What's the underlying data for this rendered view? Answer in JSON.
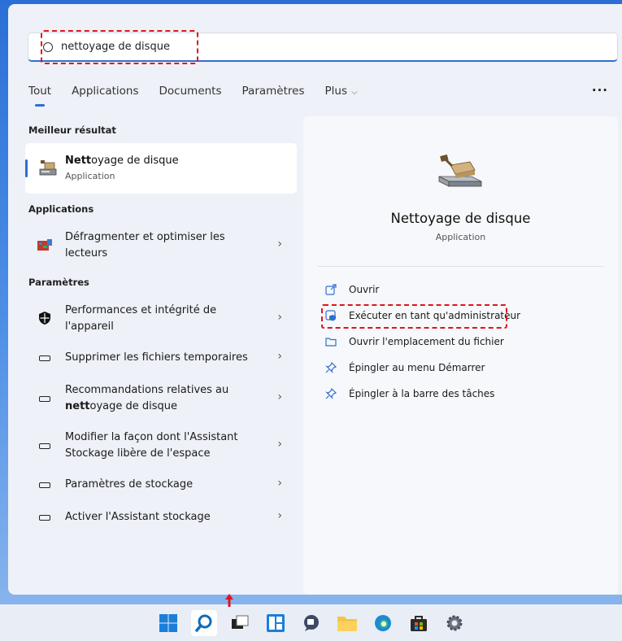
{
  "search": {
    "query": "nettoyage de disque"
  },
  "tabs": [
    {
      "label": "Tout"
    },
    {
      "label": "Applications"
    },
    {
      "label": "Documents"
    },
    {
      "label": "Paramètres"
    },
    {
      "label": "Plus"
    }
  ],
  "sections": {
    "best": "Meilleur résultat",
    "apps": "Applications",
    "settings": "Paramètres"
  },
  "best_match": {
    "name_bold": "Nett",
    "name_rest": "oyage de disque",
    "type": "Application"
  },
  "apps": [
    {
      "line1": "Défragmenter et optimiser les",
      "line2": "lecteurs"
    }
  ],
  "settings": [
    {
      "line1": "Performances et intégrité de",
      "line2": "l'appareil"
    },
    {
      "line1": "Supprimer les fichiers temporaires"
    },
    {
      "line1": "Recommandations relatives au",
      "line2_bold": "nett",
      "line2_rest": "oyage de disque"
    },
    {
      "line1": "Modifier la façon dont l'Assistant",
      "line2": "Stockage libère de l'espace"
    },
    {
      "line1": "Paramètres de stockage"
    },
    {
      "line1": "Activer l'Assistant stockage"
    }
  ],
  "detail": {
    "title": "Nettoyage de disque",
    "subtitle": "Application",
    "actions": [
      {
        "label": "Ouvrir"
      },
      {
        "label": "Exécuter en tant qu'administrateur"
      },
      {
        "label": "Ouvrir l'emplacement du fichier"
      },
      {
        "label": "Épingler au menu Démarrer"
      },
      {
        "label": "Épingler à la barre des tâches"
      }
    ]
  },
  "colors": {
    "accent": "#2f6fd0",
    "highlight": "#e0151b"
  }
}
